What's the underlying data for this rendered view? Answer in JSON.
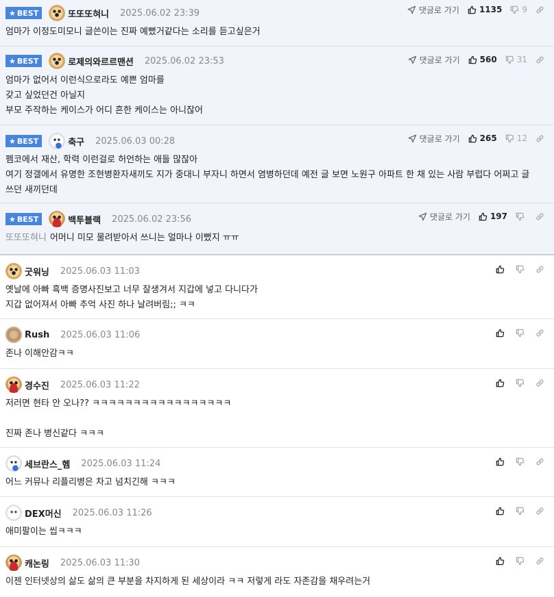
{
  "labels": {
    "best": "BEST",
    "goto_reply": "댓글로 가기"
  },
  "best_comments": [
    {
      "nickname": "또또또혀니",
      "date": "2025.06.02 23:39",
      "likes": "1135",
      "dislikes": "9",
      "lines": [
        "엄마가 이정도미모니 글쓴이는 진짜 예뻤거같다는 소리를 듣고싶은거"
      ]
    },
    {
      "nickname": "로제의와르르맨션",
      "date": "2025.06.02 23:53",
      "likes": "560",
      "dislikes": "31",
      "lines": [
        "엄마가 없어서 이런식으로라도 예쁜 엄마를",
        "갖고 싶었던건 아닐지",
        "부모 주작하는 케이스가 어디 흔한 케이스는 아니잖어"
      ]
    },
    {
      "nickname": "축구",
      "date": "2025.06.03 00:28",
      "likes": "265",
      "dislikes": "12",
      "lines": [
        "펨코에서 재산, 학력 이런걸로 허언하는 애들 많잖아",
        "여기 정갤에서 유명한 조현병환자새끼도 지가 중대니 부자니 하면서 염병하던데 예전 글 보면 노원구 아파트 한 채 있는 사람 부럽다 어쩌고 글 쓰던 새끼던데"
      ]
    },
    {
      "nickname": "백투블랙",
      "date": "2025.06.02 23:56",
      "likes": "197",
      "dislikes": "",
      "mention": "또또또혀니",
      "lines": [
        "어머니 미모 물려받아서 쓰니는 얼마나 이뻤지 ㅠㅠ"
      ]
    }
  ],
  "comments": [
    {
      "nickname": "굿워닝",
      "date": "2025.06.03 11:03",
      "lines": [
        "옛날에 아빠 흑백 증명사진보고 너무 잘생겨서 지갑에 넣고 다니다가",
        "지갑 없어져서 아빠 추억 사진 하나 날려버림;; ㅋㅋ"
      ]
    },
    {
      "nickname": "Rush",
      "date": "2025.06.03 11:06",
      "lines": [
        "존나 이해안감ㅋㅋ"
      ]
    },
    {
      "nickname": "경수진",
      "date": "2025.06.03 11:22",
      "lines": [
        "저러면 현타 안 오나?? ㅋㅋㅋㅋㅋㅋㅋㅋㅋㅋㅋㅋㅋㅋㅋㅋㅋ",
        "",
        "진짜 존나 병신같다 ㅋㅋㅋ"
      ]
    },
    {
      "nickname": "세브란스_헴",
      "date": "2025.06.03 11:24",
      "lines": [
        "어느 커뮤나 리플리병은 차고 넘치긴해 ㅋㅋㅋ"
      ]
    },
    {
      "nickname": "DEX머신",
      "date": "2025.06.03 11:26",
      "lines": [
        "애미팔이는 씹ㅋㅋㅋ"
      ]
    },
    {
      "nickname": "캐논링",
      "date": "2025.06.03 11:30",
      "lines": [
        "이젠 인터넷상의 삶도 삶의 큰 부분을 차지하게 된 세상이라 ㅋㅋ 저렇게 라도 자존감을 채우려는거"
      ]
    }
  ],
  "avatars": [
    "puppy-avatar",
    "puppy-avatar",
    "bear-avatar",
    "puppy-scarf-avatar",
    "puppy-avatar",
    "blurred-avatar",
    "puppy-scarf-avatar",
    "bear-avatar",
    "white-dog-avatar",
    "puppy-scarf-avatar"
  ],
  "colors": {
    "best_badge": "#4a86d8",
    "best_background": "#f1f4fa",
    "mention": "#8a8a8a"
  }
}
